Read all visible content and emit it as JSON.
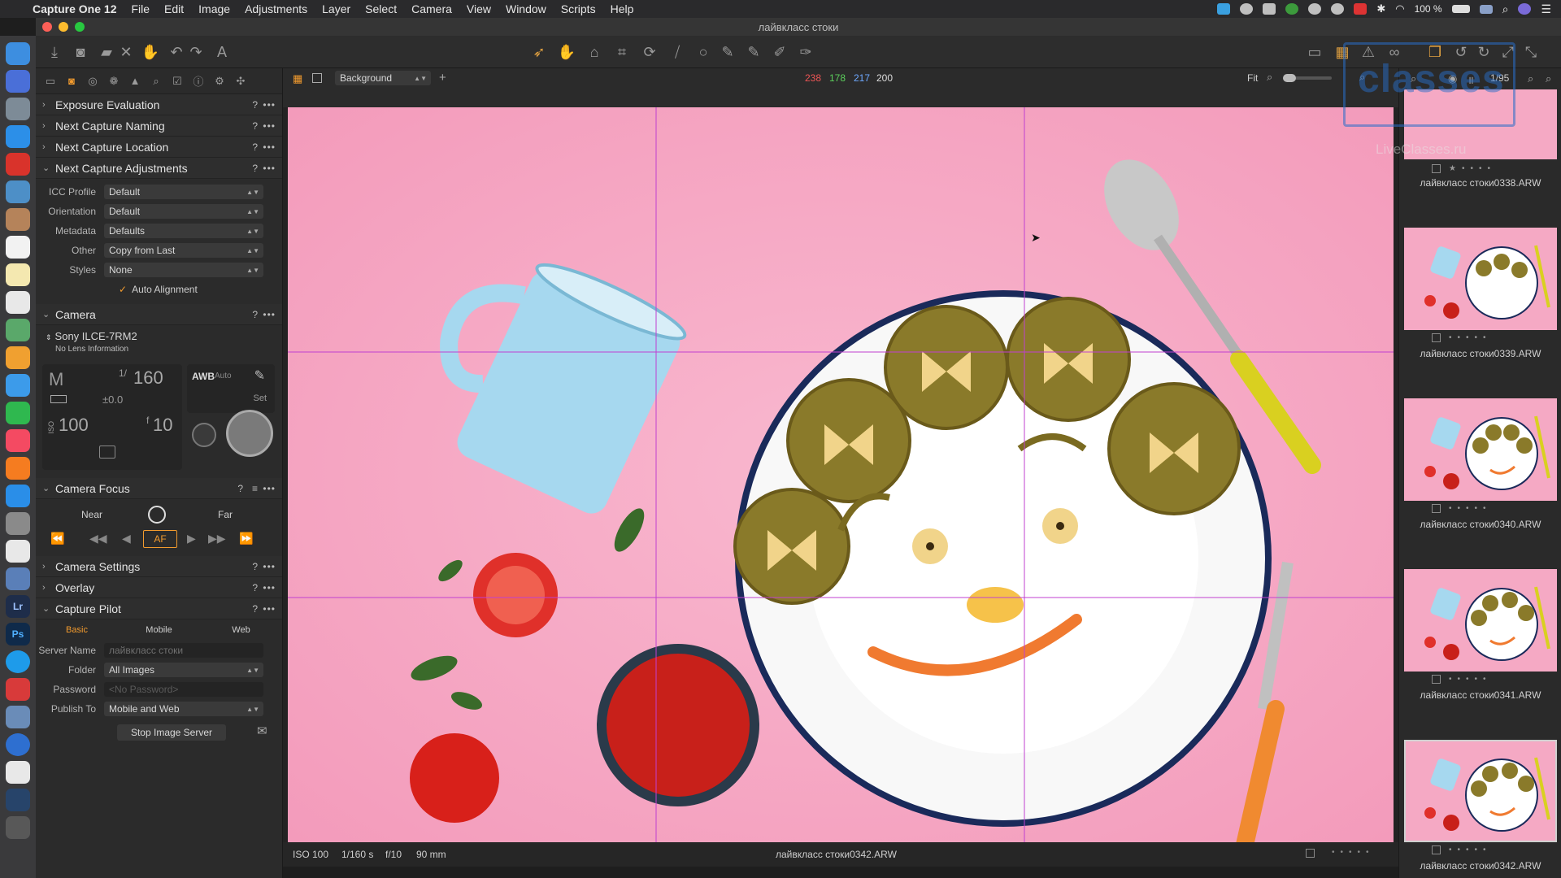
{
  "menubar": {
    "app_name": "Capture One 12",
    "items": [
      "File",
      "Edit",
      "Image",
      "Adjustments",
      "Layer",
      "Select",
      "Camera",
      "View",
      "Window",
      "Scripts",
      "Help"
    ],
    "battery": "100 %"
  },
  "window": {
    "title": "лайвкласс стоки"
  },
  "viewer_top": {
    "variant": "Background",
    "rgb": {
      "r": "238",
      "g": "178",
      "b": "217",
      "l": "200"
    },
    "zoom_label": "Fit",
    "counter": "1/95"
  },
  "left": {
    "sections": {
      "exposure_eval": "Exposure Evaluation",
      "next_naming": "Next Capture Naming",
      "next_location": "Next Capture Location",
      "next_adjust": "Next Capture Adjustments",
      "camera": "Camera",
      "camera_focus": "Camera Focus",
      "camera_settings": "Camera Settings",
      "overlay": "Overlay",
      "capture_pilot": "Capture Pilot"
    },
    "adjust_rows": [
      {
        "label": "ICC Profile",
        "value": "Default"
      },
      {
        "label": "Orientation",
        "value": "Default"
      },
      {
        "label": "Metadata",
        "value": "Defaults"
      },
      {
        "label": "Other",
        "value": "Copy from Last"
      },
      {
        "label": "Styles",
        "value": "None"
      }
    ],
    "auto_alignment": "Auto Alignment",
    "camera": {
      "model": "Sony ILCE-7RM2",
      "lens": "No Lens Information",
      "mode": "M",
      "shutter_prefix": "1/",
      "shutter": "160",
      "ev": "±0.0",
      "iso_label": "ISO",
      "iso": "100",
      "aperture_prefix": "f",
      "aperture": "10",
      "wb": "AWB",
      "wb_mode": "Auto",
      "set": "Set"
    },
    "focus": {
      "near": "Near",
      "far": "Far",
      "af": "AF"
    },
    "pilot": {
      "tabs": [
        "Basic",
        "Mobile",
        "Web"
      ],
      "server_name_label": "Server Name",
      "server_name": "лайвкласс стоки",
      "folder_label": "Folder",
      "folder": "All Images",
      "password_label": "Password",
      "password_placeholder": "<No Password>",
      "publish_label": "Publish To",
      "publish": "Mobile and Web",
      "stop_button": "Stop Image Server"
    }
  },
  "status": {
    "iso": "ISO 100",
    "shutter": "1/160 s",
    "aperture": "f/10",
    "focal": "90 mm",
    "filename": "лайвкласс стоки0342.ARW"
  },
  "browser": {
    "thumbs": [
      {
        "name": "лайвкласс стоки0338.ARW"
      },
      {
        "name": "лайвкласс стоки0339.ARW"
      },
      {
        "name": "лайвкласс стоки0340.ARW"
      },
      {
        "name": "лайвкласс стоки0341.ARW"
      },
      {
        "name": "лайвкласс стоки0342.ARW"
      }
    ],
    "watermark": "classes",
    "watermark_sub": "LiveClasses.ru"
  },
  "colors": {
    "accent": "#f29b2e",
    "photo_bg": "#f5a9c4",
    "grid_line": "#c040d0"
  }
}
